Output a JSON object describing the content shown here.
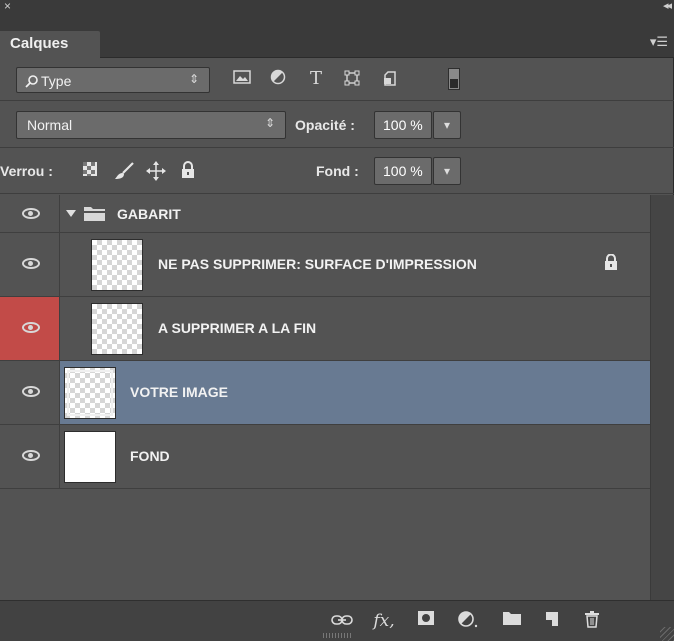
{
  "window": {
    "close_glyph": "×",
    "collapse_glyph": "◂◂"
  },
  "panel": {
    "tab_title": "Calques",
    "menu_icon": "panel-menu-icon"
  },
  "filter": {
    "kind_label": "Type",
    "kind_arrow": "⇕",
    "icons": [
      "image-filter-icon",
      "adjustment-filter-icon",
      "text-filter-icon",
      "shape-filter-icon",
      "smart-object-filter-icon"
    ],
    "toggle_icon": "filter-toggle-icon"
  },
  "blend": {
    "mode": "Normal",
    "mode_arrow": "⇕",
    "opacity_label": "Opacité :",
    "opacity_value": "100 %"
  },
  "lock": {
    "label": "Verrou :",
    "icons": [
      "lock-transparent-pixels-icon",
      "lock-image-pixels-icon",
      "lock-position-icon",
      "lock-all-icon"
    ],
    "fill_label": "Fond :",
    "fill_value": "100 %"
  },
  "layers": [
    {
      "name": "GABARIT",
      "type": "group",
      "expanded": true,
      "visible": true
    },
    {
      "name": "NE PAS SUPPRIMER: SURFACE D'IMPRESSION",
      "type": "layer",
      "locked": true,
      "visible": true,
      "indent": true
    },
    {
      "name": "A SUPPRIMER A LA FIN",
      "type": "layer",
      "visible": true,
      "indent": true,
      "eye_highlight": "#c24b48"
    },
    {
      "name": "VOTRE IMAGE",
      "type": "layer",
      "visible": true,
      "selected": true,
      "selected_color": "#687a92"
    },
    {
      "name": "FOND",
      "type": "layer",
      "visible": true,
      "white_fill": true
    }
  ],
  "bottom_icons": [
    "link-layers-icon",
    "fx-icon",
    "add-mask-icon",
    "new-adjustment-icon",
    "new-group-icon",
    "new-layer-icon",
    "delete-icon"
  ],
  "bottom": {
    "fx_text": "fx"
  }
}
